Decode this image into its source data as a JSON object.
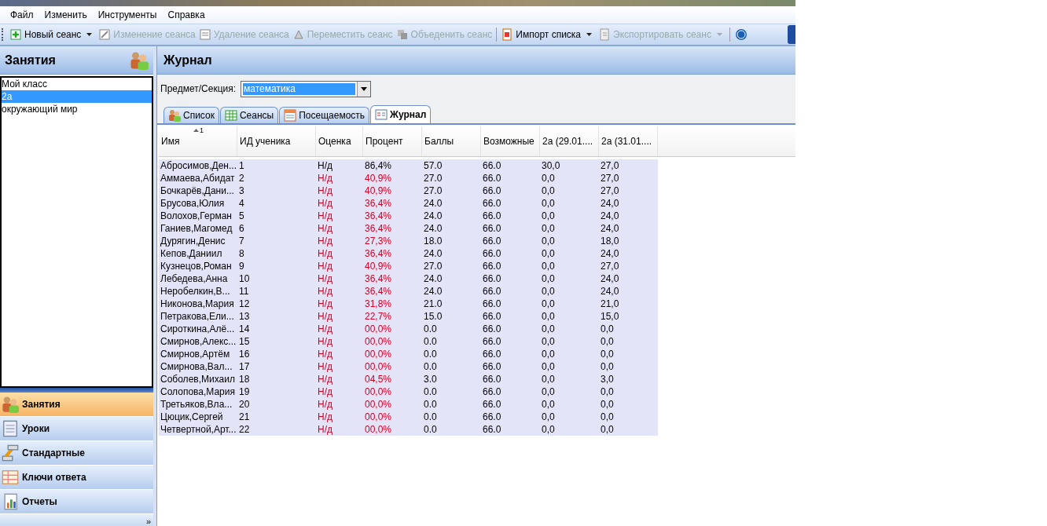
{
  "menu": [
    "Файл",
    "Изменить",
    "Инструменты",
    "Справка"
  ],
  "toolbar": [
    {
      "label": "Новый сеанс",
      "disabled": false,
      "dropdown": true
    },
    {
      "label": "Изменение сеанса",
      "disabled": true,
      "dropdown": false
    },
    {
      "label": "Удаление сеанса",
      "disabled": true,
      "dropdown": false
    },
    {
      "label": "Переместить сеанс",
      "disabled": true,
      "dropdown": false
    },
    {
      "label": "Объеденить сеанс",
      "disabled": true,
      "dropdown": false
    },
    {
      "label": "Импорт списка",
      "disabled": false,
      "dropdown": true
    },
    {
      "label": "Экспортировать сеанс",
      "disabled": true,
      "dropdown": true
    }
  ],
  "sidebar": {
    "title": "Занятия",
    "items": [
      {
        "label": "Мой класс",
        "selected": false
      },
      {
        "label": "2а",
        "selected": true
      },
      {
        "label": "окружающий мир",
        "selected": false
      }
    ],
    "nav": [
      {
        "label": "Занятия",
        "selected": true
      },
      {
        "label": "Уроки",
        "selected": false
      },
      {
        "label": "Стандартные",
        "selected": false
      },
      {
        "label": "Ключи ответа",
        "selected": false
      },
      {
        "label": "Отчеты",
        "selected": false
      }
    ],
    "more": "»"
  },
  "main": {
    "title": "Журнал",
    "subject_label": "Предмет/Секция:",
    "subject_value": "математика",
    "tabs": [
      {
        "label": "Список",
        "selected": false
      },
      {
        "label": "Сеансы",
        "selected": false
      },
      {
        "label": "Посещаемость",
        "selected": false
      },
      {
        "label": "Журнал",
        "selected": true
      }
    ],
    "table": {
      "sort_mark": "1",
      "columns": [
        "Имя",
        "ИД ученика",
        "Оценка",
        "Процент",
        "Баллы",
        "Возможные",
        "2а (29.01....",
        "2а (31.01...."
      ],
      "rows": [
        {
          "cells": [
            "Абросимов,Ден...",
            "1",
            "Н/д",
            "86,4%",
            "57.0",
            "66.0",
            "30,0",
            "27,0"
          ],
          "low": false
        },
        {
          "cells": [
            "Аммаева,Абидат",
            "2",
            "Н/д",
            "40,9%",
            "27.0",
            "66.0",
            "0,0",
            "27,0"
          ],
          "low": true
        },
        {
          "cells": [
            "Бочкарёв,Дани...",
            "3",
            "Н/д",
            "40,9%",
            "27.0",
            "66.0",
            "0,0",
            "27,0"
          ],
          "low": true
        },
        {
          "cells": [
            "Брусова,Юлия",
            "4",
            "Н/д",
            "36,4%",
            "24.0",
            "66.0",
            "0,0",
            "24,0"
          ],
          "low": true
        },
        {
          "cells": [
            "Волохов,Герман",
            "5",
            "Н/д",
            "36,4%",
            "24.0",
            "66.0",
            "0,0",
            "24,0"
          ],
          "low": true
        },
        {
          "cells": [
            "Ганиев,Магомед",
            "6",
            "Н/д",
            "36,4%",
            "24.0",
            "66.0",
            "0,0",
            "24,0"
          ],
          "low": true
        },
        {
          "cells": [
            "Дурягин,Денис",
            "7",
            "Н/д",
            "27,3%",
            "18.0",
            "66.0",
            "0,0",
            "18,0"
          ],
          "low": true
        },
        {
          "cells": [
            "Кепов,Даниил",
            "8",
            "Н/д",
            "36,4%",
            "24.0",
            "66.0",
            "0,0",
            "24,0"
          ],
          "low": true
        },
        {
          "cells": [
            "Кузнецов,Роман",
            "9",
            "Н/д",
            "40,9%",
            "27.0",
            "66.0",
            "0,0",
            "27,0"
          ],
          "low": true
        },
        {
          "cells": [
            "Лебедева,Анна",
            "10",
            "Н/д",
            "36,4%",
            "24.0",
            "66.0",
            "0,0",
            "24,0"
          ],
          "low": true
        },
        {
          "cells": [
            "Неробелкин,В...",
            "11",
            "Н/д",
            "36,4%",
            "24.0",
            "66.0",
            "0,0",
            "24,0"
          ],
          "low": true
        },
        {
          "cells": [
            "Никонова,Мария",
            "12",
            "Н/д",
            "31,8%",
            "21.0",
            "66.0",
            "0,0",
            "21,0"
          ],
          "low": true
        },
        {
          "cells": [
            "Петракова,Ели...",
            "13",
            "Н/д",
            "22,7%",
            "15.0",
            "66.0",
            "0,0",
            "15,0"
          ],
          "low": true
        },
        {
          "cells": [
            "Сироткина,Алё...",
            "14",
            "Н/д",
            "00,0%",
            "0.0",
            "66.0",
            "0,0",
            "0,0"
          ],
          "low": true
        },
        {
          "cells": [
            "Смирнов,Алекс...",
            "15",
            "Н/д",
            "00,0%",
            "0.0",
            "66.0",
            "0,0",
            "0,0"
          ],
          "low": true
        },
        {
          "cells": [
            "Смирнов,Артём",
            "16",
            "Н/д",
            "00,0%",
            "0.0",
            "66.0",
            "0,0",
            "0,0"
          ],
          "low": true
        },
        {
          "cells": [
            "Смирнова,Вал...",
            "17",
            "Н/д",
            "00,0%",
            "0.0",
            "66.0",
            "0,0",
            "0,0"
          ],
          "low": true
        },
        {
          "cells": [
            "Соболев,Михаил",
            "18",
            "Н/д",
            "04,5%",
            "3.0",
            "66.0",
            "0,0",
            "3,0"
          ],
          "low": true
        },
        {
          "cells": [
            "Солопова,Мария",
            "19",
            "Н/д",
            "00,0%",
            "0.0",
            "66.0",
            "0,0",
            "0,0"
          ],
          "low": true
        },
        {
          "cells": [
            "Третьяков,Вла...",
            "20",
            "Н/д",
            "00,0%",
            "0.0",
            "66.0",
            "0,0",
            "0,0"
          ],
          "low": true
        },
        {
          "cells": [
            "Цюцик,Сергей",
            "21",
            "Н/д",
            "00,0%",
            "0.0",
            "66.0",
            "0,0",
            "0,0"
          ],
          "low": true
        },
        {
          "cells": [
            "Четвертной,Арт...",
            "22",
            "Н/д",
            "00,0%",
            "0.0",
            "66.0",
            "0,0",
            "0,0"
          ],
          "low": true
        }
      ]
    }
  }
}
